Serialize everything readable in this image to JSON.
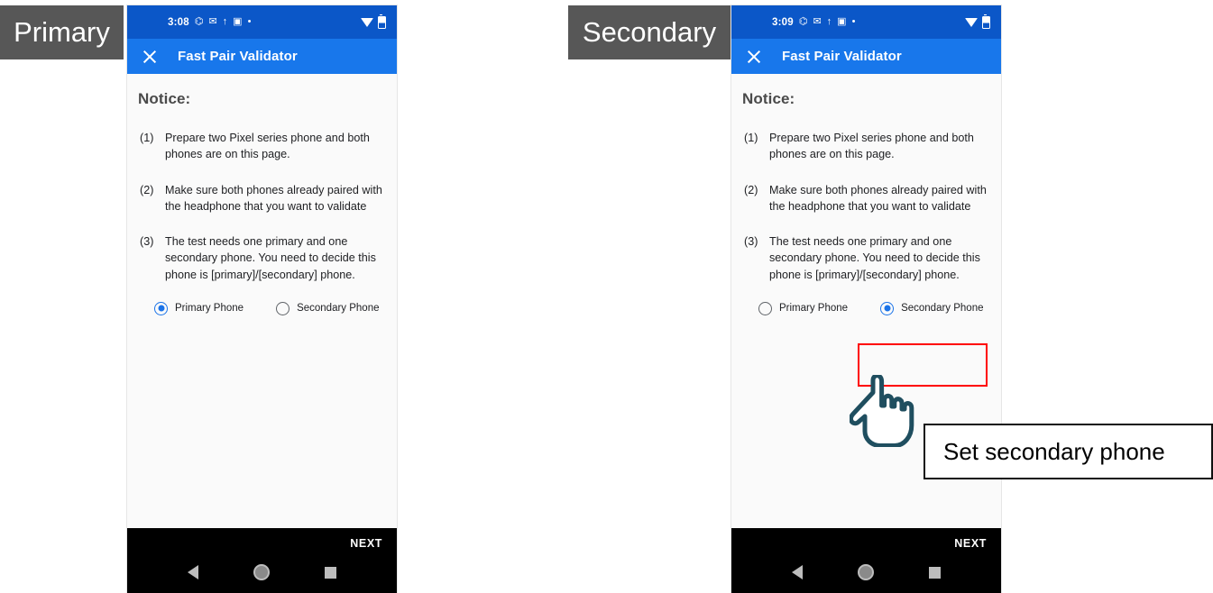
{
  "panels": [
    {
      "label": "Primary",
      "statusbar": {
        "time": "3:08",
        "icons": [
          "notification-icon",
          "gmail-icon",
          "hangouts-icon",
          "youtube-icon",
          "dot-icon"
        ],
        "wifi": "wifi-icon",
        "battery": "battery-icon"
      },
      "appbar": {
        "close": "close-icon",
        "title": "Fast Pair Validator"
      },
      "notice_heading": "Notice:",
      "items": [
        {
          "num": "(1)",
          "text": "Prepare two Pixel series phone and both phones are on this page."
        },
        {
          "num": "(2)",
          "text": "Make sure both phones already paired with the headphone that you want to validate"
        },
        {
          "num": "(3)",
          "text": "The test needs one primary and one secondary phone. You need to decide this phone is [primary]/[secondary] phone."
        }
      ],
      "radios": [
        {
          "label": "Primary Phone",
          "selected": true
        },
        {
          "label": "Secondary Phone",
          "selected": false
        }
      ],
      "next_label": "NEXT",
      "nav": [
        "back-icon",
        "home-icon",
        "recents-icon"
      ]
    },
    {
      "label": "Secondary",
      "statusbar": {
        "time": "3:09",
        "icons": [
          "notification-icon",
          "gmail-icon",
          "hangouts-icon",
          "youtube-icon",
          "dot-icon"
        ],
        "wifi": "wifi-icon",
        "battery": "battery-icon"
      },
      "appbar": {
        "close": "close-icon",
        "title": "Fast Pair Validator"
      },
      "notice_heading": "Notice:",
      "items": [
        {
          "num": "(1)",
          "text": "Prepare two Pixel series phone and both phones are on this page."
        },
        {
          "num": "(2)",
          "text": "Make sure both phones already paired with the headphone that you want to validate"
        },
        {
          "num": "(3)",
          "text": "The test needs one primary and one secondary phone. You need to decide this phone is [primary]/[secondary] phone."
        }
      ],
      "radios": [
        {
          "label": "Primary Phone",
          "selected": false
        },
        {
          "label": "Secondary Phone",
          "selected": true
        }
      ],
      "next_label": "NEXT",
      "nav": [
        "back-icon",
        "home-icon",
        "recents-icon"
      ]
    }
  ],
  "annotations": {
    "highlight_color": "#FF0000",
    "callout_text": "Set secondary phone",
    "cursor": "hand-pointer-cursor"
  }
}
